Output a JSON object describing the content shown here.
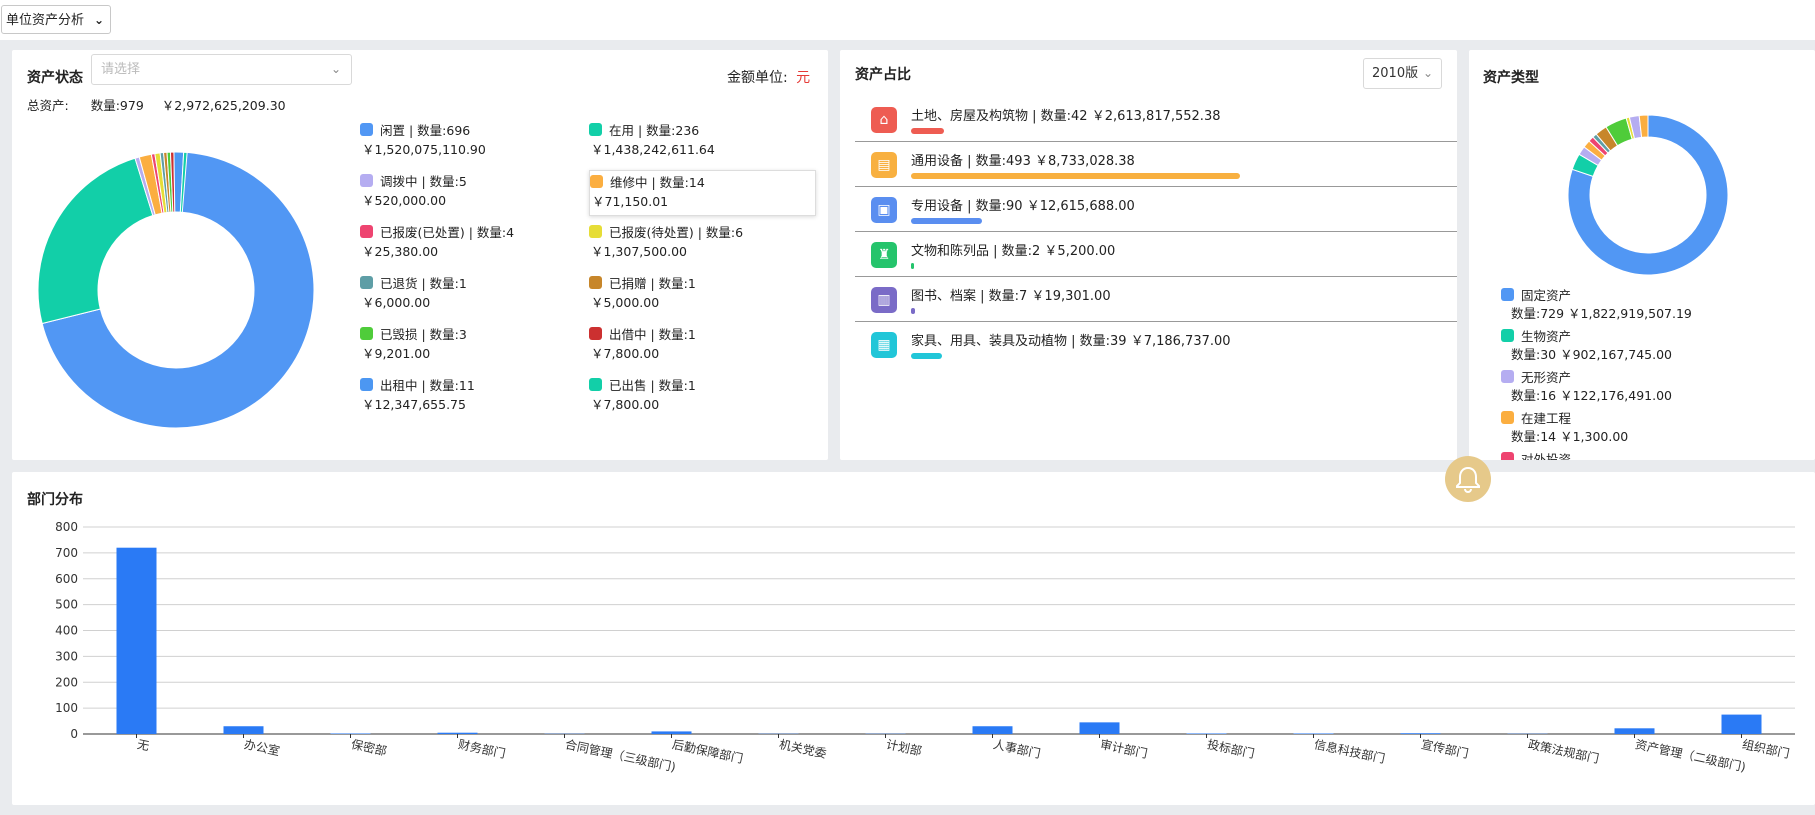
{
  "header": {
    "view_select": "单位资产分析"
  },
  "status_card": {
    "title": "资产状态",
    "select_placeholder": "请选择",
    "unit_label": "金额单位:",
    "unit_value": "元",
    "unit_color": "#e53935",
    "total_label": "总资产:",
    "total_count": "数量:979",
    "total_amount": "￥2,972,625,209.30",
    "legend": [
      {
        "label": "闲置 | 数量:696",
        "amount": "￥1,520,075,110.90",
        "color": "#5197f4"
      },
      {
        "label": "在用 | 数量:236",
        "amount": "￥1,438,242,611.64",
        "color": "#12cfa8"
      },
      {
        "label": "调拨中 | 数量:5",
        "amount": "￥520,000.00",
        "color": "#b5adf1"
      },
      {
        "label": "维修中 | 数量:14",
        "amount": "￥71,150.01",
        "color": "#fbae40"
      },
      {
        "label": "已报废(已处置) | 数量:4",
        "amount": "￥25,380.00",
        "color": "#ee4470"
      },
      {
        "label": "已报废(待处置) | 数量:6",
        "amount": "￥1,307,500.00",
        "color": "#e6dd37"
      },
      {
        "label": "已退货 | 数量:1",
        "amount": "￥6,000.00",
        "color": "#5e9ea6"
      },
      {
        "label": "已捐赠 | 数量:1",
        "amount": "￥5,000.00",
        "color": "#c7862a"
      },
      {
        "label": "已毁损 | 数量:3",
        "amount": "￥9,201.00",
        "color": "#4fcc3a"
      },
      {
        "label": "出借中 | 数量:1",
        "amount": "￥7,800.00",
        "color": "#cc3030"
      },
      {
        "label": "出租中 | 数量:11",
        "amount": "￥12,347,655.75",
        "color": "#4c97f2"
      },
      {
        "label": "已出售 | 数量:1",
        "amount": "￥7,800.00",
        "color": "#12cfa8"
      }
    ],
    "counts": [
      696,
      236,
      5,
      14,
      4,
      6,
      1,
      1,
      3,
      1,
      11,
      1
    ]
  },
  "ratio_card": {
    "title": "资产占比",
    "version_select": "2010版",
    "rows": [
      {
        "text": "土地、房屋及构筑物 | 数量:42  ￥2,613,817,552.38",
        "color": "#ee5c52",
        "icon": "house-icon",
        "fill": 0.06
      },
      {
        "text": "通用设备 | 数量:493  ￥8,733,028.38",
        "color": "#f8b040",
        "icon": "monitor-icon",
        "fill": 0.6
      },
      {
        "text": "专用设备 | 数量:90  ￥12,615,688.00",
        "color": "#5a8ef0",
        "icon": "screen-icon",
        "fill": 0.13
      },
      {
        "text": "文物和陈列品 | 数量:2  ￥5,200.00",
        "color": "#25c46c",
        "icon": "artifact-icon",
        "fill": 0.004
      },
      {
        "text": "图书、档案 | 数量:7  ￥19,301.00",
        "color": "#7a6bc7",
        "icon": "book-icon",
        "fill": 0.008
      },
      {
        "text": "家具、用具、装具及动植物 | 数量:39  ￥7,186,737.00",
        "color": "#21c6d8",
        "icon": "sofa-icon",
        "fill": 0.057
      }
    ]
  },
  "type_card": {
    "title": "资产类型",
    "items": [
      {
        "label": "固定资产",
        "detail": "数量:729   ￥1,822,919,507.19",
        "color": "#5197f4"
      },
      {
        "label": "生物资产",
        "detail": "数量:30   ￥902,167,745.00",
        "color": "#12cfa8"
      },
      {
        "label": "无形资产",
        "detail": "数量:16   ￥122,176,491.00",
        "color": "#b5adf1"
      },
      {
        "label": "在建工程",
        "detail": "数量:14   ￥1,300.00",
        "color": "#fbae40"
      },
      {
        "label": "对外投资",
        "detail": "",
        "color": "#ee4470"
      }
    ],
    "donut_slices": [
      {
        "value": 729,
        "color": "#5197f4"
      },
      {
        "value": 30,
        "color": "#12cfa8"
      },
      {
        "value": 16,
        "color": "#b5adf1"
      },
      {
        "value": 14,
        "color": "#fbae40"
      },
      {
        "value": 10,
        "color": "#ee4470"
      },
      {
        "value": 8,
        "color": "#5e9ea6"
      },
      {
        "value": 22,
        "color": "#c7862a"
      },
      {
        "value": 40,
        "color": "#4fcc3a"
      },
      {
        "value": 6,
        "color": "#e6dd37"
      },
      {
        "value": 18,
        "color": "#b5adf1"
      },
      {
        "value": 16,
        "color": "#fbae40"
      }
    ]
  },
  "dept_card": {
    "title": "部门分布",
    "chart_data": {
      "type": "bar",
      "categories": [
        "无",
        "办公室",
        "保密部",
        "财务部门",
        "合同管理（三级部门)",
        "后勤保障部门",
        "机关党委",
        "计划部",
        "人事部门",
        "审计部门",
        "投标部门",
        "信息科技部门",
        "宣传部门",
        "政策法规部门",
        "资产管理（二级部门)",
        "组织部门"
      ],
      "values": [
        720,
        30,
        2,
        5,
        1,
        10,
        1,
        1,
        30,
        45,
        2,
        2,
        3,
        1,
        22,
        75
      ],
      "ylim": [
        0,
        800
      ],
      "yticks": [
        0,
        100,
        200,
        300,
        400,
        500,
        600,
        700,
        800
      ],
      "bar_color": "#2a7af5",
      "grid": true
    }
  }
}
